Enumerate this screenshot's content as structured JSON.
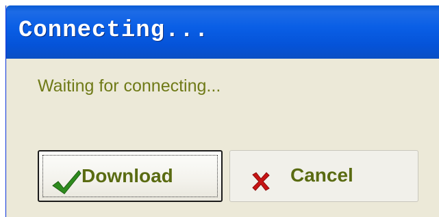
{
  "window": {
    "title": "Connecting..."
  },
  "status": {
    "message": "Waiting for connecting..."
  },
  "buttons": {
    "download_label": "Download",
    "cancel_label": "Cancel",
    "download_icon": "check-icon",
    "cancel_icon": "x-icon"
  },
  "colors": {
    "titlebar": "#0553d8",
    "window_bg": "#ece9d8",
    "text_olive": "#6f7a17",
    "check_green": "#2e8b1e",
    "cancel_red": "#c81414"
  }
}
